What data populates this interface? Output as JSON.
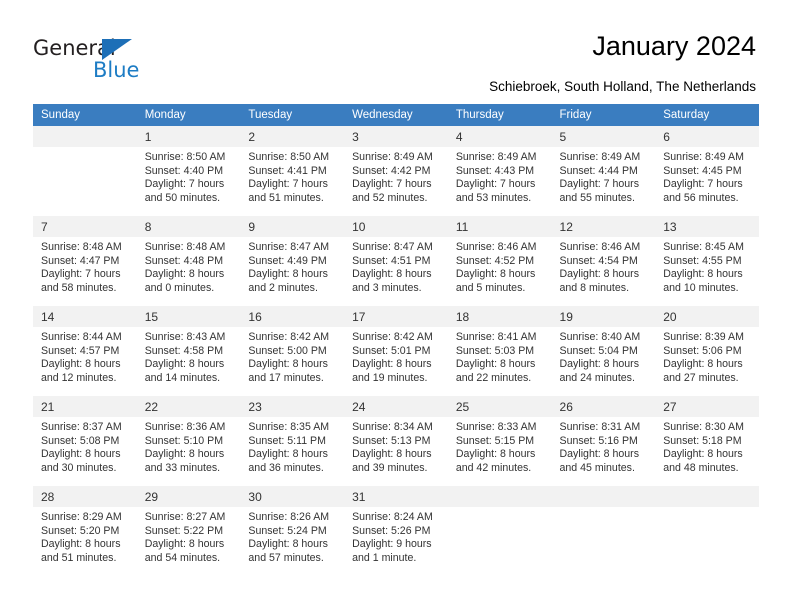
{
  "brand": {
    "name_part1": "General",
    "name_part2": "Blue",
    "triangle_color": "#1d6fb7",
    "blue_color": "#1d7cc4"
  },
  "header": {
    "title": "January 2024",
    "subtitle": "Schiebroek, South Holland, The Netherlands",
    "header_bg": "#3a7dc0"
  },
  "calendar": {
    "weekdays": [
      "Sunday",
      "Monday",
      "Tuesday",
      "Wednesday",
      "Thursday",
      "Friday",
      "Saturday"
    ],
    "weeks": [
      [
        {
          "day": "",
          "sunrise": "",
          "sunset": "",
          "daylight_line1": "",
          "daylight_line2": ""
        },
        {
          "day": "1",
          "sunrise": "Sunrise: 8:50 AM",
          "sunset": "Sunset: 4:40 PM",
          "daylight_line1": "Daylight: 7 hours",
          "daylight_line2": "and 50 minutes."
        },
        {
          "day": "2",
          "sunrise": "Sunrise: 8:50 AM",
          "sunset": "Sunset: 4:41 PM",
          "daylight_line1": "Daylight: 7 hours",
          "daylight_line2": "and 51 minutes."
        },
        {
          "day": "3",
          "sunrise": "Sunrise: 8:49 AM",
          "sunset": "Sunset: 4:42 PM",
          "daylight_line1": "Daylight: 7 hours",
          "daylight_line2": "and 52 minutes."
        },
        {
          "day": "4",
          "sunrise": "Sunrise: 8:49 AM",
          "sunset": "Sunset: 4:43 PM",
          "daylight_line1": "Daylight: 7 hours",
          "daylight_line2": "and 53 minutes."
        },
        {
          "day": "5",
          "sunrise": "Sunrise: 8:49 AM",
          "sunset": "Sunset: 4:44 PM",
          "daylight_line1": "Daylight: 7 hours",
          "daylight_line2": "and 55 minutes."
        },
        {
          "day": "6",
          "sunrise": "Sunrise: 8:49 AM",
          "sunset": "Sunset: 4:45 PM",
          "daylight_line1": "Daylight: 7 hours",
          "daylight_line2": "and 56 minutes."
        }
      ],
      [
        {
          "day": "7",
          "sunrise": "Sunrise: 8:48 AM",
          "sunset": "Sunset: 4:47 PM",
          "daylight_line1": "Daylight: 7 hours",
          "daylight_line2": "and 58 minutes."
        },
        {
          "day": "8",
          "sunrise": "Sunrise: 8:48 AM",
          "sunset": "Sunset: 4:48 PM",
          "daylight_line1": "Daylight: 8 hours",
          "daylight_line2": "and 0 minutes."
        },
        {
          "day": "9",
          "sunrise": "Sunrise: 8:47 AM",
          "sunset": "Sunset: 4:49 PM",
          "daylight_line1": "Daylight: 8 hours",
          "daylight_line2": "and 2 minutes."
        },
        {
          "day": "10",
          "sunrise": "Sunrise: 8:47 AM",
          "sunset": "Sunset: 4:51 PM",
          "daylight_line1": "Daylight: 8 hours",
          "daylight_line2": "and 3 minutes."
        },
        {
          "day": "11",
          "sunrise": "Sunrise: 8:46 AM",
          "sunset": "Sunset: 4:52 PM",
          "daylight_line1": "Daylight: 8 hours",
          "daylight_line2": "and 5 minutes."
        },
        {
          "day": "12",
          "sunrise": "Sunrise: 8:46 AM",
          "sunset": "Sunset: 4:54 PM",
          "daylight_line1": "Daylight: 8 hours",
          "daylight_line2": "and 8 minutes."
        },
        {
          "day": "13",
          "sunrise": "Sunrise: 8:45 AM",
          "sunset": "Sunset: 4:55 PM",
          "daylight_line1": "Daylight: 8 hours",
          "daylight_line2": "and 10 minutes."
        }
      ],
      [
        {
          "day": "14",
          "sunrise": "Sunrise: 8:44 AM",
          "sunset": "Sunset: 4:57 PM",
          "daylight_line1": "Daylight: 8 hours",
          "daylight_line2": "and 12 minutes."
        },
        {
          "day": "15",
          "sunrise": "Sunrise: 8:43 AM",
          "sunset": "Sunset: 4:58 PM",
          "daylight_line1": "Daylight: 8 hours",
          "daylight_line2": "and 14 minutes."
        },
        {
          "day": "16",
          "sunrise": "Sunrise: 8:42 AM",
          "sunset": "Sunset: 5:00 PM",
          "daylight_line1": "Daylight: 8 hours",
          "daylight_line2": "and 17 minutes."
        },
        {
          "day": "17",
          "sunrise": "Sunrise: 8:42 AM",
          "sunset": "Sunset: 5:01 PM",
          "daylight_line1": "Daylight: 8 hours",
          "daylight_line2": "and 19 minutes."
        },
        {
          "day": "18",
          "sunrise": "Sunrise: 8:41 AM",
          "sunset": "Sunset: 5:03 PM",
          "daylight_line1": "Daylight: 8 hours",
          "daylight_line2": "and 22 minutes."
        },
        {
          "day": "19",
          "sunrise": "Sunrise: 8:40 AM",
          "sunset": "Sunset: 5:04 PM",
          "daylight_line1": "Daylight: 8 hours",
          "daylight_line2": "and 24 minutes."
        },
        {
          "day": "20",
          "sunrise": "Sunrise: 8:39 AM",
          "sunset": "Sunset: 5:06 PM",
          "daylight_line1": "Daylight: 8 hours",
          "daylight_line2": "and 27 minutes."
        }
      ],
      [
        {
          "day": "21",
          "sunrise": "Sunrise: 8:37 AM",
          "sunset": "Sunset: 5:08 PM",
          "daylight_line1": "Daylight: 8 hours",
          "daylight_line2": "and 30 minutes."
        },
        {
          "day": "22",
          "sunrise": "Sunrise: 8:36 AM",
          "sunset": "Sunset: 5:10 PM",
          "daylight_line1": "Daylight: 8 hours",
          "daylight_line2": "and 33 minutes."
        },
        {
          "day": "23",
          "sunrise": "Sunrise: 8:35 AM",
          "sunset": "Sunset: 5:11 PM",
          "daylight_line1": "Daylight: 8 hours",
          "daylight_line2": "and 36 minutes."
        },
        {
          "day": "24",
          "sunrise": "Sunrise: 8:34 AM",
          "sunset": "Sunset: 5:13 PM",
          "daylight_line1": "Daylight: 8 hours",
          "daylight_line2": "and 39 minutes."
        },
        {
          "day": "25",
          "sunrise": "Sunrise: 8:33 AM",
          "sunset": "Sunset: 5:15 PM",
          "daylight_line1": "Daylight: 8 hours",
          "daylight_line2": "and 42 minutes."
        },
        {
          "day": "26",
          "sunrise": "Sunrise: 8:31 AM",
          "sunset": "Sunset: 5:16 PM",
          "daylight_line1": "Daylight: 8 hours",
          "daylight_line2": "and 45 minutes."
        },
        {
          "day": "27",
          "sunrise": "Sunrise: 8:30 AM",
          "sunset": "Sunset: 5:18 PM",
          "daylight_line1": "Daylight: 8 hours",
          "daylight_line2": "and 48 minutes."
        }
      ],
      [
        {
          "day": "28",
          "sunrise": "Sunrise: 8:29 AM",
          "sunset": "Sunset: 5:20 PM",
          "daylight_line1": "Daylight: 8 hours",
          "daylight_line2": "and 51 minutes."
        },
        {
          "day": "29",
          "sunrise": "Sunrise: 8:27 AM",
          "sunset": "Sunset: 5:22 PM",
          "daylight_line1": "Daylight: 8 hours",
          "daylight_line2": "and 54 minutes."
        },
        {
          "day": "30",
          "sunrise": "Sunrise: 8:26 AM",
          "sunset": "Sunset: 5:24 PM",
          "daylight_line1": "Daylight: 8 hours",
          "daylight_line2": "and 57 minutes."
        },
        {
          "day": "31",
          "sunrise": "Sunrise: 8:24 AM",
          "sunset": "Sunset: 5:26 PM",
          "daylight_line1": "Daylight: 9 hours",
          "daylight_line2": "and 1 minute."
        },
        {
          "day": "",
          "sunrise": "",
          "sunset": "",
          "daylight_line1": "",
          "daylight_line2": ""
        },
        {
          "day": "",
          "sunrise": "",
          "sunset": "",
          "daylight_line1": "",
          "daylight_line2": ""
        },
        {
          "day": "",
          "sunrise": "",
          "sunset": "",
          "daylight_line1": "",
          "daylight_line2": ""
        }
      ]
    ]
  }
}
